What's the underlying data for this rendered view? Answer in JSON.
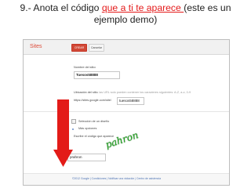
{
  "instruction": {
    "part1": "9.- Anota el código ",
    "link": "que a ti te aparece ",
    "part2": "(este es un",
    "line2": "ejemplo demo)"
  },
  "page": {
    "logo": "Sites",
    "buttons": {
      "create": "CREAR",
      "cancel": "Cancelar"
    },
    "site_name": {
      "label": "Nombre del sitio:",
      "value": "Tuesos58888"
    },
    "location": {
      "label": "Ubicación del sitio",
      "hint": "- las URL solo pueden contener los caracteres siguientes: A-Z, a-z, 0-9",
      "prefix": "https://sites.google.com/site/",
      "value": "tuesos58888"
    },
    "options": {
      "item1": "Selección de un diseño",
      "item2": "Más opciones"
    },
    "captcha": {
      "label": "Escribe el código que aparece",
      "text": "pahron",
      "value": "prahron"
    },
    "footer": "©2012 Google | Condiciones | Notificar una violación | Centro de asistencia"
  }
}
